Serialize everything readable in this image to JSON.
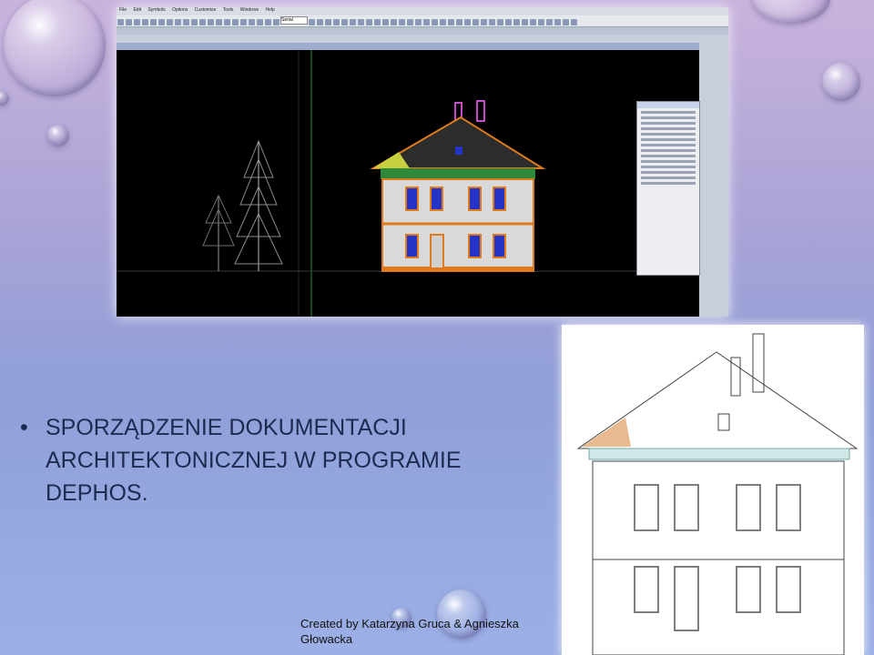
{
  "app": {
    "menu": [
      "File",
      "Edit",
      "Symbols",
      "Options",
      "Customize",
      "Tools",
      "Windows",
      "Help"
    ],
    "toolbar_input": "Serial"
  },
  "slide": {
    "bullet_symbol": "•",
    "bullet_text": "SPORZĄDZENIE DOKUMENTACJI ARCHITEKTONICZNEJ W PROGRAMIE DEPHOS.",
    "credit": "Created by Katarzyna Gruca & Agnieszka Głowacka"
  },
  "colors": {
    "accent": "#1f2a50",
    "roof": "#2c2c2c",
    "wall": "#d9d9d9",
    "trim": "#e07b1a",
    "window": "#2433c8"
  }
}
